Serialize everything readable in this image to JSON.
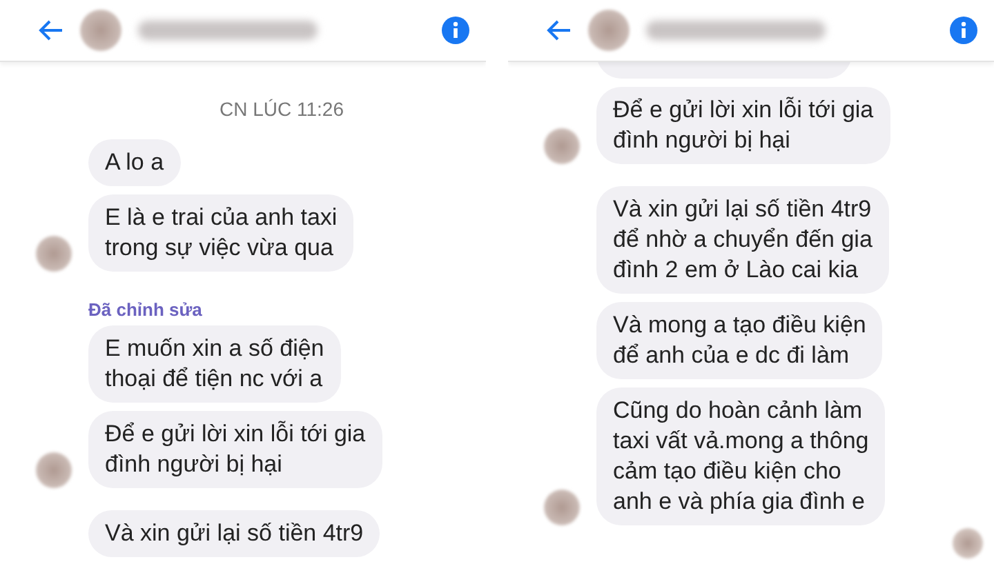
{
  "panels": [
    {
      "seen": false,
      "items": [
        {
          "kind": "timestamp",
          "text": "CN LÚC 11:26"
        },
        {
          "kind": "message",
          "text": "A lo a",
          "avatar": false
        },
        {
          "kind": "message",
          "text": "E là e trai của anh taxi\ntrong sự việc vừa qua",
          "avatar": true
        },
        {
          "kind": "edited",
          "text": "Đã chỉnh sửa"
        },
        {
          "kind": "message",
          "text": "E muốn xin a số điện\nthoại để tiện nc với a",
          "avatar": false
        },
        {
          "kind": "message",
          "text": "Để e gửi lời xin lỗi tới gia\nđình người bị hại",
          "avatar": true
        },
        {
          "kind": "message",
          "text": "Và xin gửi lại số tiền 4tr9",
          "avatar": false
        }
      ]
    },
    {
      "seen": true,
      "items": [
        {
          "kind": "cut_message"
        },
        {
          "kind": "message",
          "text": "Để e gửi lời xin lỗi tới gia\nđình người bị hại",
          "avatar": true
        },
        {
          "kind": "message",
          "text": "Và xin gửi lại số tiền 4tr9\nđể nhờ a chuyển đến gia\nđình 2 em ở Lào cai kia",
          "avatar": false
        },
        {
          "kind": "message",
          "text": "Và mong a tạo điều kiện\nđể anh của e dc đi làm",
          "avatar": false
        },
        {
          "kind": "message",
          "text": "Cũng do hoàn cảnh làm\ntaxi vất vả.mong a thông\ncảm tạo điều kiện cho\nanh e và phía gia đình e",
          "avatar": true
        }
      ]
    }
  ]
}
